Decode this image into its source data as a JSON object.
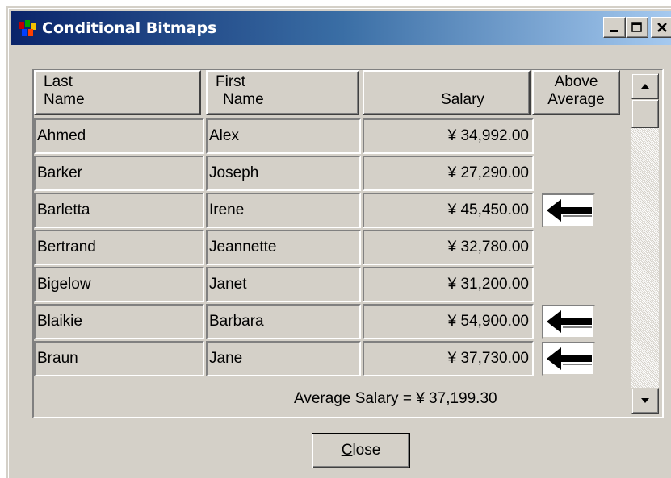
{
  "window": {
    "title": "Conditional Bitmaps",
    "icon": "app-icon",
    "controls": [
      {
        "name": "minimize-icon",
        "glyph": "_"
      },
      {
        "name": "maximize-icon",
        "glyph": "□"
      },
      {
        "name": "close-icon",
        "glyph": "×"
      }
    ]
  },
  "table": {
    "headers": [
      {
        "line1": "Last",
        "line2": "Name"
      },
      {
        "line1": "First",
        "line2": "Name"
      },
      {
        "line1": "",
        "line2": "Salary"
      },
      {
        "line1": "Above",
        "line2": "Average"
      }
    ],
    "rows": [
      {
        "last": "Ahmed",
        "first": "Alex",
        "salary": "¥ 34,992.00",
        "above_average": false
      },
      {
        "last": "Barker",
        "first": "Joseph",
        "salary": "¥ 27,290.00",
        "above_average": false
      },
      {
        "last": "Barletta",
        "first": "Irene",
        "salary": "¥ 45,450.00",
        "above_average": true
      },
      {
        "last": "Bertrand",
        "first": "Jeannette",
        "salary": "¥ 32,780.00",
        "above_average": false
      },
      {
        "last": "Bigelow",
        "first": "Janet",
        "salary": "¥ 31,200.00",
        "above_average": false
      },
      {
        "last": "Blaikie",
        "first": "Barbara",
        "salary": "¥ 54,900.00",
        "above_average": true
      },
      {
        "last": "Braun",
        "first": "Jane",
        "salary": "¥ 37,730.00",
        "above_average": true
      }
    ],
    "average_text": "Average Salary = ¥ 37,199.30",
    "above_average_icon": "left-arrow-icon"
  },
  "buttons": {
    "close_mnemonic": "C",
    "close_rest": "lose"
  },
  "colors": {
    "face": "#d4d0c8",
    "title_start": "#0a246a",
    "title_end": "#a6caf0"
  }
}
